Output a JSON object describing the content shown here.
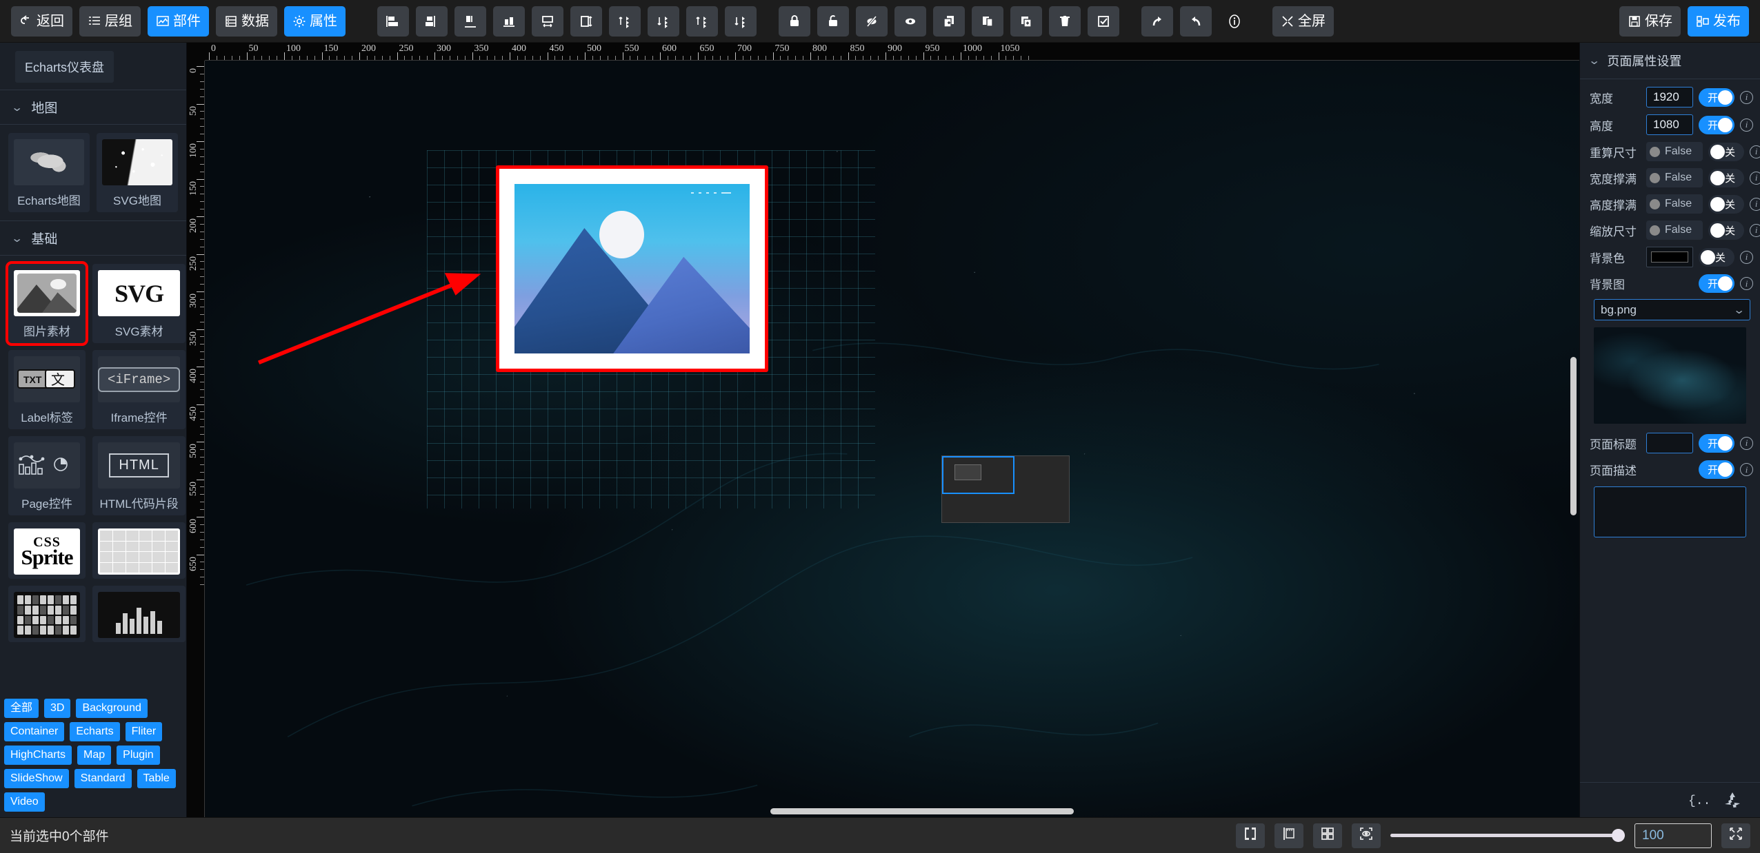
{
  "toolbar": {
    "left_buttons": [
      {
        "label": "返回",
        "icon": "back-icon",
        "active": false
      },
      {
        "label": "层组",
        "icon": "layers-icon",
        "active": false
      },
      {
        "label": "部件",
        "icon": "widget-icon",
        "active": true
      },
      {
        "label": "数据",
        "icon": "database-icon",
        "active": false
      },
      {
        "label": "属性",
        "icon": "gear-icon",
        "active": true
      }
    ],
    "align_icons": [
      "align-left-icon",
      "align-center-horizontal-icon",
      "align-right-icon",
      "align-top-icon",
      "align-middle-vertical-icon",
      "align-bottom-icon",
      "distribute-horizontal-icon",
      "distribute-vertical-icon",
      "size-equal-width-icon",
      "size-equal-height-icon",
      "size-equal-both-icon",
      "size-auto-icon"
    ],
    "action_icons": [
      "lock-icon",
      "unlock-icon",
      "hide-icon",
      "show-icon",
      "copy-icon",
      "paste-icon",
      "duplicate-icon",
      "delete-icon",
      "select-all-icon"
    ],
    "history_icons": [
      "redo-icon",
      "undo-icon",
      "info-icon"
    ],
    "fullscreen_label": "全屏",
    "fullscreen_icon": "fullscreen-icon",
    "save_label": "保存",
    "save_icon": "save-icon",
    "publish_label": "发布",
    "publish_icon": "publish-icon"
  },
  "left_panel": {
    "breadcrumb_chip": "Echarts仪表盘",
    "sections": [
      {
        "title": "地图",
        "expanded": true,
        "items": [
          {
            "label": "Echarts地图",
            "thumb": "map-thumb",
            "selected": false
          },
          {
            "label": "SVG地图",
            "thumb": "svgmap-thumb",
            "selected": false
          }
        ]
      },
      {
        "title": "基础",
        "expanded": true,
        "items": [
          {
            "label": "图片素材",
            "thumb": "image-thumb",
            "selected": true
          },
          {
            "label": "SVG素材",
            "thumb": "svg-thumb",
            "selected": false
          },
          {
            "label": "Label标签",
            "thumb": "txt-thumb",
            "selected": false
          },
          {
            "label": "Iframe控件",
            "thumb": "iframe-thumb",
            "selected": false
          },
          {
            "label": "Page控件",
            "thumb": "page-thumb",
            "selected": false
          },
          {
            "label": "HTML代码片段",
            "thumb": "html-thumb",
            "selected": false
          }
        ]
      }
    ],
    "partial_items": [
      {
        "thumb": "css-sprite-thumb"
      },
      {
        "thumb": "table-thumb"
      },
      {
        "thumb": "bar-thumb"
      },
      {
        "thumb": "dots-thumb"
      }
    ],
    "filter_tags": [
      "全部",
      "3D",
      "Background",
      "Container",
      "Echarts",
      "Fliter",
      "HighCharts",
      "Map",
      "Plugin",
      "SlideShow",
      "Standard",
      "Table",
      "Video"
    ]
  },
  "canvas": {
    "ruler_horizontal_labels": [
      "0",
      "50",
      "100",
      "150",
      "200",
      "250",
      "300",
      "350",
      "400",
      "450",
      "500",
      "550",
      "600",
      "650",
      "700",
      "750",
      "800",
      "850",
      "900",
      "950",
      "1000",
      "1050"
    ],
    "ruler_vertical_labels": [
      "0",
      "50",
      "100",
      "150",
      "200",
      "250",
      "300",
      "350",
      "400",
      "450",
      "500",
      "550",
      "600",
      "650"
    ],
    "selected_element": "image-placeholder",
    "annotation": "red-arrow-pointing-to-image"
  },
  "right_panel": {
    "title": "页面属性设置",
    "rows": [
      {
        "label": "宽度",
        "type": "input",
        "value": "1920",
        "toggle": "on",
        "toggle_text": "开"
      },
      {
        "label": "高度",
        "type": "input",
        "value": "1080",
        "toggle": "on",
        "toggle_text": "开"
      },
      {
        "label": "重算尺寸",
        "type": "false",
        "value": "False",
        "toggle": "off",
        "toggle_text": "关"
      },
      {
        "label": "宽度撑满",
        "type": "false",
        "value": "False",
        "toggle": "off",
        "toggle_text": "关"
      },
      {
        "label": "高度撑满",
        "type": "false",
        "value": "False",
        "toggle": "off",
        "toggle_text": "关"
      },
      {
        "label": "缩放尺寸",
        "type": "false",
        "value": "False",
        "toggle": "off",
        "toggle_text": "关"
      },
      {
        "label": "背景色",
        "type": "color",
        "value": "#000000",
        "toggle": "off",
        "toggle_text": "关"
      }
    ],
    "bg_image": {
      "label": "背景图",
      "toggle": "on",
      "toggle_text": "开",
      "selected_file": "bg.png"
    },
    "page_title": {
      "label": "页面标题",
      "value": "",
      "toggle": "on",
      "toggle_text": "开"
    },
    "page_desc": {
      "label": "页面描述",
      "value": "",
      "toggle": "on",
      "toggle_text": "开"
    },
    "footer_icons": [
      "json-braces-icon",
      "recycle-icon"
    ]
  },
  "statusbar": {
    "selection_text": "当前选中0个部件",
    "tool_icons": [
      "frame-icon",
      "ruler-icon",
      "grid-icon",
      "preview-icon"
    ],
    "zoom_value": "100",
    "zoom_percent": 100,
    "fullscreen_icon": "collapse-icon"
  },
  "colors": {
    "accent": "#1890ff",
    "panel_bg": "#1b2028",
    "toolbar_bg": "#1d1d1d",
    "canvas_bg": "#050b10",
    "annotation_red": "#ff0000"
  }
}
